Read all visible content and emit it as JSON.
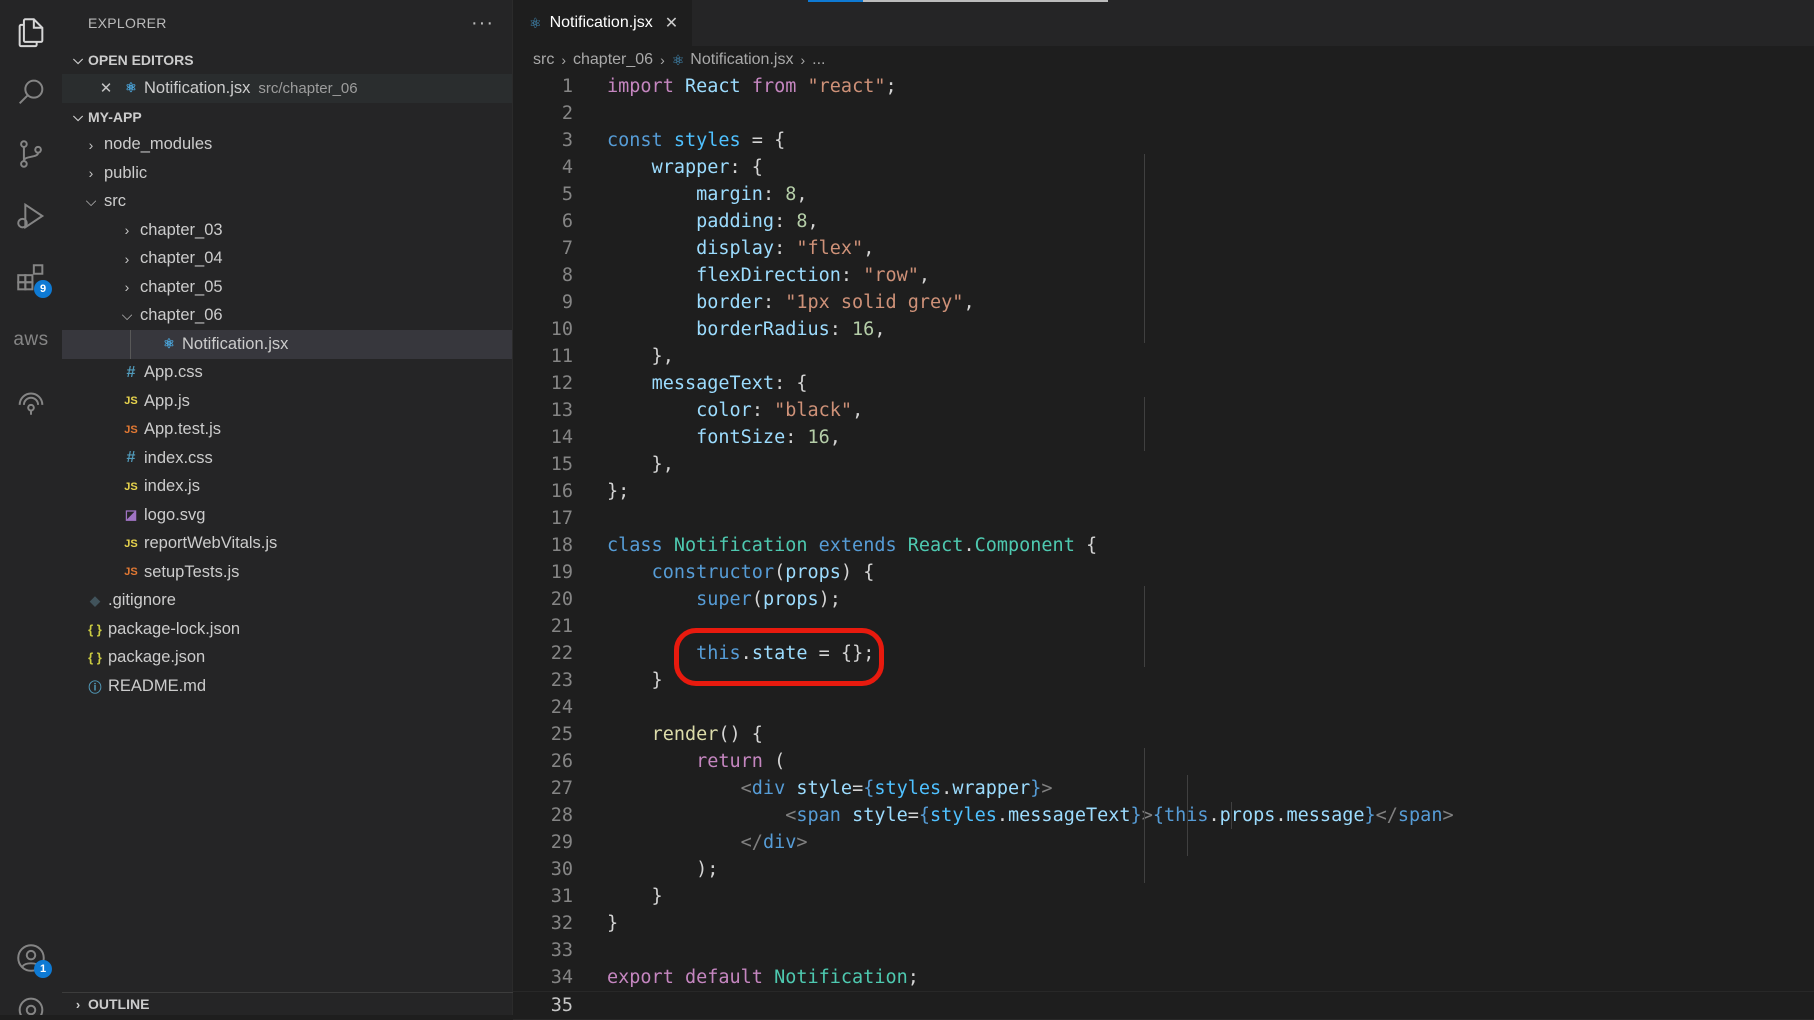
{
  "sidebar": {
    "title": "EXPLORER",
    "more": "···",
    "open_editors_label": "OPEN EDITORS",
    "open_editor": {
      "name": "Notification.jsx",
      "path": "src/chapter_06"
    },
    "project_label": "MY-APP",
    "outline_label": "OUTLINE",
    "tree": {
      "node_modules": "node_modules",
      "public": "public",
      "src": "src",
      "chapter_03": "chapter_03",
      "chapter_04": "chapter_04",
      "chapter_05": "chapter_05",
      "chapter_06": "chapter_06",
      "notification": "Notification.jsx",
      "app_css": "App.css",
      "app_js": "App.js",
      "app_test": "App.test.js",
      "index_css": "index.css",
      "index_js": "index.js",
      "logo": "logo.svg",
      "report": "reportWebVitals.js",
      "setup": "setupTests.js",
      "gitignore": ".gitignore",
      "pkg_lock": "package-lock.json",
      "pkg": "package.json",
      "readme": "README.md"
    }
  },
  "activity": {
    "extensions_badge": "9",
    "accounts_badge": "1",
    "aws_label": "aws"
  },
  "tab": {
    "label": "Notification.jsx"
  },
  "breadcrumb": {
    "src": "src",
    "folder": "chapter_06",
    "file": "Notification.jsx",
    "more": "..."
  },
  "code": {
    "ln": [
      "1",
      "2",
      "3",
      "4",
      "5",
      "6",
      "7",
      "8",
      "9",
      "10",
      "11",
      "12",
      "13",
      "14",
      "15",
      "16",
      "17",
      "18",
      "19",
      "20",
      "21",
      "22",
      "23",
      "24",
      "25",
      "26",
      "27",
      "28",
      "29",
      "30",
      "31",
      "32",
      "33",
      "34",
      "35"
    ]
  }
}
